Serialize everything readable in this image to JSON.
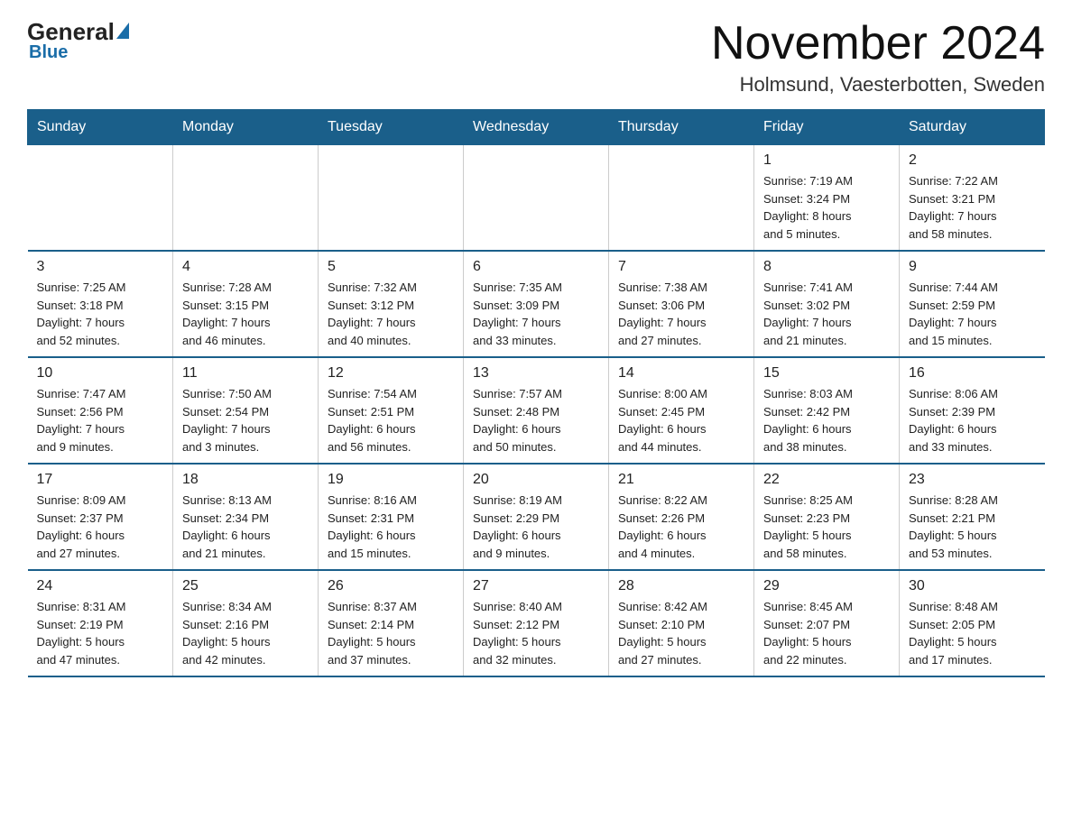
{
  "logo": {
    "general": "General",
    "blue": "Blue"
  },
  "header": {
    "title": "November 2024",
    "subtitle": "Holmsund, Vaesterbotten, Sweden"
  },
  "weekdays": [
    "Sunday",
    "Monday",
    "Tuesday",
    "Wednesday",
    "Thursday",
    "Friday",
    "Saturday"
  ],
  "weeks": [
    [
      {
        "day": "",
        "info": ""
      },
      {
        "day": "",
        "info": ""
      },
      {
        "day": "",
        "info": ""
      },
      {
        "day": "",
        "info": ""
      },
      {
        "day": "",
        "info": ""
      },
      {
        "day": "1",
        "info": "Sunrise: 7:19 AM\nSunset: 3:24 PM\nDaylight: 8 hours\nand 5 minutes."
      },
      {
        "day": "2",
        "info": "Sunrise: 7:22 AM\nSunset: 3:21 PM\nDaylight: 7 hours\nand 58 minutes."
      }
    ],
    [
      {
        "day": "3",
        "info": "Sunrise: 7:25 AM\nSunset: 3:18 PM\nDaylight: 7 hours\nand 52 minutes."
      },
      {
        "day": "4",
        "info": "Sunrise: 7:28 AM\nSunset: 3:15 PM\nDaylight: 7 hours\nand 46 minutes."
      },
      {
        "day": "5",
        "info": "Sunrise: 7:32 AM\nSunset: 3:12 PM\nDaylight: 7 hours\nand 40 minutes."
      },
      {
        "day": "6",
        "info": "Sunrise: 7:35 AM\nSunset: 3:09 PM\nDaylight: 7 hours\nand 33 minutes."
      },
      {
        "day": "7",
        "info": "Sunrise: 7:38 AM\nSunset: 3:06 PM\nDaylight: 7 hours\nand 27 minutes."
      },
      {
        "day": "8",
        "info": "Sunrise: 7:41 AM\nSunset: 3:02 PM\nDaylight: 7 hours\nand 21 minutes."
      },
      {
        "day": "9",
        "info": "Sunrise: 7:44 AM\nSunset: 2:59 PM\nDaylight: 7 hours\nand 15 minutes."
      }
    ],
    [
      {
        "day": "10",
        "info": "Sunrise: 7:47 AM\nSunset: 2:56 PM\nDaylight: 7 hours\nand 9 minutes."
      },
      {
        "day": "11",
        "info": "Sunrise: 7:50 AM\nSunset: 2:54 PM\nDaylight: 7 hours\nand 3 minutes."
      },
      {
        "day": "12",
        "info": "Sunrise: 7:54 AM\nSunset: 2:51 PM\nDaylight: 6 hours\nand 56 minutes."
      },
      {
        "day": "13",
        "info": "Sunrise: 7:57 AM\nSunset: 2:48 PM\nDaylight: 6 hours\nand 50 minutes."
      },
      {
        "day": "14",
        "info": "Sunrise: 8:00 AM\nSunset: 2:45 PM\nDaylight: 6 hours\nand 44 minutes."
      },
      {
        "day": "15",
        "info": "Sunrise: 8:03 AM\nSunset: 2:42 PM\nDaylight: 6 hours\nand 38 minutes."
      },
      {
        "day": "16",
        "info": "Sunrise: 8:06 AM\nSunset: 2:39 PM\nDaylight: 6 hours\nand 33 minutes."
      }
    ],
    [
      {
        "day": "17",
        "info": "Sunrise: 8:09 AM\nSunset: 2:37 PM\nDaylight: 6 hours\nand 27 minutes."
      },
      {
        "day": "18",
        "info": "Sunrise: 8:13 AM\nSunset: 2:34 PM\nDaylight: 6 hours\nand 21 minutes."
      },
      {
        "day": "19",
        "info": "Sunrise: 8:16 AM\nSunset: 2:31 PM\nDaylight: 6 hours\nand 15 minutes."
      },
      {
        "day": "20",
        "info": "Sunrise: 8:19 AM\nSunset: 2:29 PM\nDaylight: 6 hours\nand 9 minutes."
      },
      {
        "day": "21",
        "info": "Sunrise: 8:22 AM\nSunset: 2:26 PM\nDaylight: 6 hours\nand 4 minutes."
      },
      {
        "day": "22",
        "info": "Sunrise: 8:25 AM\nSunset: 2:23 PM\nDaylight: 5 hours\nand 58 minutes."
      },
      {
        "day": "23",
        "info": "Sunrise: 8:28 AM\nSunset: 2:21 PM\nDaylight: 5 hours\nand 53 minutes."
      }
    ],
    [
      {
        "day": "24",
        "info": "Sunrise: 8:31 AM\nSunset: 2:19 PM\nDaylight: 5 hours\nand 47 minutes."
      },
      {
        "day": "25",
        "info": "Sunrise: 8:34 AM\nSunset: 2:16 PM\nDaylight: 5 hours\nand 42 minutes."
      },
      {
        "day": "26",
        "info": "Sunrise: 8:37 AM\nSunset: 2:14 PM\nDaylight: 5 hours\nand 37 minutes."
      },
      {
        "day": "27",
        "info": "Sunrise: 8:40 AM\nSunset: 2:12 PM\nDaylight: 5 hours\nand 32 minutes."
      },
      {
        "day": "28",
        "info": "Sunrise: 8:42 AM\nSunset: 2:10 PM\nDaylight: 5 hours\nand 27 minutes."
      },
      {
        "day": "29",
        "info": "Sunrise: 8:45 AM\nSunset: 2:07 PM\nDaylight: 5 hours\nand 22 minutes."
      },
      {
        "day": "30",
        "info": "Sunrise: 8:48 AM\nSunset: 2:05 PM\nDaylight: 5 hours\nand 17 minutes."
      }
    ]
  ]
}
